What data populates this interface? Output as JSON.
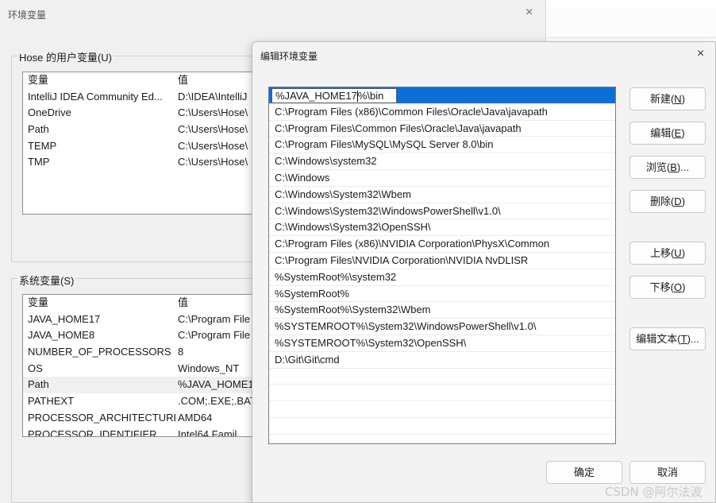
{
  "background_window": {
    "title": "环境变量",
    "close_glyph": "×",
    "user_vars_label": "Hose 的用户变量(U)",
    "system_vars_label": "系统变量(S)",
    "columns": [
      "变量",
      "值"
    ],
    "user_vars": [
      {
        "name": "IntelliJ IDEA Community Ed...",
        "value": "D:\\IDEA\\IntelliJ"
      },
      {
        "name": "OneDrive",
        "value": "C:\\Users\\Hose\\"
      },
      {
        "name": "Path",
        "value": "C:\\Users\\Hose\\"
      },
      {
        "name": "TEMP",
        "value": "C:\\Users\\Hose\\"
      },
      {
        "name": "TMP",
        "value": "C:\\Users\\Hose\\"
      }
    ],
    "system_vars": [
      {
        "name": "JAVA_HOME17",
        "value": "C:\\Program File"
      },
      {
        "name": "JAVA_HOME8",
        "value": "C:\\Program File"
      },
      {
        "name": "NUMBER_OF_PROCESSORS",
        "value": "8"
      },
      {
        "name": "OS",
        "value": "Windows_NT"
      },
      {
        "name": "Path",
        "value": "%JAVA_HOME1",
        "selected": true
      },
      {
        "name": "PATHEXT",
        "value": ".COM;.EXE;.BAT"
      },
      {
        "name": "PROCESSOR_ARCHITECTURE",
        "value": "AMD64"
      },
      {
        "name": "PROCESSOR_IDENTIFIER",
        "value": "Intel64 Famil"
      }
    ]
  },
  "dialog": {
    "title": "编辑环境变量",
    "close_glyph": "×",
    "editing_entry": {
      "before_caret": "%JAVA_HOME17",
      "after_caret": "%\\bin"
    },
    "path_entries": [
      "C:\\Program Files (x86)\\Common Files\\Oracle\\Java\\javapath",
      "C:\\Program Files\\Common Files\\Oracle\\Java\\javapath",
      "C:\\Program Files\\MySQL\\MySQL Server 8.0\\bin",
      "C:\\Windows\\system32",
      "C:\\Windows",
      "C:\\Windows\\System32\\Wbem",
      "C:\\Windows\\System32\\WindowsPowerShell\\v1.0\\",
      "C:\\Windows\\System32\\OpenSSH\\",
      "C:\\Program Files (x86)\\NVIDIA Corporation\\PhysX\\Common",
      "C:\\Program Files\\NVIDIA Corporation\\NVIDIA NvDLISR",
      "%SystemRoot%\\system32",
      "%SystemRoot%",
      "%SystemRoot%\\System32\\Wbem",
      "%SYSTEMROOT%\\System32\\WindowsPowerShell\\v1.0\\",
      "%SYSTEMROOT%\\System32\\OpenSSH\\",
      "D:\\Git\\Git\\cmd",
      "",
      "",
      "",
      "",
      ""
    ],
    "buttons": {
      "new": {
        "text": "新建(",
        "key": "N",
        "tail": ")"
      },
      "edit": {
        "text": "编辑(",
        "key": "E",
        "tail": ")"
      },
      "browse": {
        "text": "浏览(",
        "key": "B",
        "tail": ")..."
      },
      "delete": {
        "text": "删除(",
        "key": "D",
        "tail": ")"
      },
      "move_up": {
        "text": "上移(",
        "key": "U",
        "tail": ")"
      },
      "move_down": {
        "text": "下移(",
        "key": "O",
        "tail": ")"
      },
      "edit_text": {
        "text": "编辑文本(",
        "key": "T",
        "tail": ")..."
      },
      "ok": "确定",
      "cancel": "取消"
    }
  },
  "watermark": "CSDN @阿尔法波"
}
